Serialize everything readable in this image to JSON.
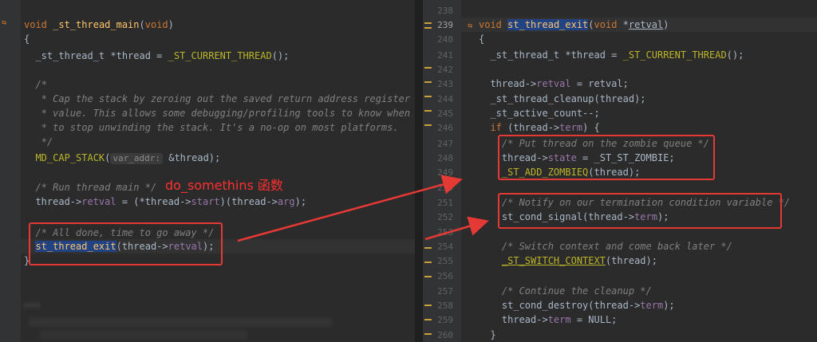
{
  "annotation": "do_somethins 函数",
  "left": {
    "lines": [
      {
        "t": "void _st_thread_main(void)"
      },
      {
        "t": "{"
      },
      {
        "t": "  _st_thread_t *thread = _ST_CURRENT_THREAD();"
      },
      {
        "t": ""
      },
      {
        "t": "  /*"
      },
      {
        "t": "   * Cap the stack by zeroing out the saved return address register"
      },
      {
        "t": "   * value. This allows some debugging/profiling tools to know when"
      },
      {
        "t": "   * to stop unwinding the stack. It's a no-op on most platforms."
      },
      {
        "t": "   */"
      },
      {
        "t": "  MD_CAP_STACK(",
        "hint": "var_addr:",
        "rest": " &thread);"
      },
      {
        "t": ""
      },
      {
        "t": "  /* Run thread main */"
      },
      {
        "t": "  thread->retval = (*thread->start)(thread->arg);"
      },
      {
        "t": ""
      },
      {
        "t": "  /* All done, time to go away */"
      },
      {
        "t": "  st_thread_exit(thread->retval);"
      },
      {
        "t": "}"
      }
    ]
  },
  "right": {
    "line_numbers": [
      "238",
      "239",
      "240",
      "241",
      "242",
      "243",
      "244",
      "245",
      "246",
      "247",
      "248",
      "249",
      "250",
      "251",
      "252",
      "253",
      "254",
      "255",
      "256",
      "257",
      "258",
      "259",
      "260"
    ],
    "current_line": "239",
    "lines": [
      {
        "t": ""
      },
      {
        "t": "void st_thread_exit(void *retval)"
      },
      {
        "t": "{"
      },
      {
        "t": "  _st_thread_t *thread = _ST_CURRENT_THREAD();"
      },
      {
        "t": ""
      },
      {
        "t": "  thread->retval = retval;"
      },
      {
        "t": "  _st_thread_cleanup(thread);"
      },
      {
        "t": "  _st_active_count--;"
      },
      {
        "t": "  if (thread->term) {"
      },
      {
        "t": "    /* Put thread on the zombie queue */"
      },
      {
        "t": "    thread->state = _ST_ST_ZOMBIE;"
      },
      {
        "t": "    _ST_ADD_ZOMBIEQ(thread);"
      },
      {
        "t": ""
      },
      {
        "t": "    /* Notify on our termination condition variable */"
      },
      {
        "t": "    st_cond_signal(thread->term);"
      },
      {
        "t": ""
      },
      {
        "t": "    /* Switch context and come back later */"
      },
      {
        "t": "    _ST_SWITCH_CONTEXT(thread);"
      },
      {
        "t": ""
      },
      {
        "t": "    /* Continue the cleanup */"
      },
      {
        "t": "    st_cond_destroy(thread->term);"
      },
      {
        "t": "    thread->term = NULL;"
      },
      {
        "t": "  }"
      }
    ]
  },
  "colors": {
    "background": "#2b2b2b",
    "keyword": "#cc7832",
    "function": "#ffc66d",
    "comment": "#808080",
    "member": "#9876aa",
    "annotation": "#ff2f2f",
    "selection": "#214283"
  }
}
